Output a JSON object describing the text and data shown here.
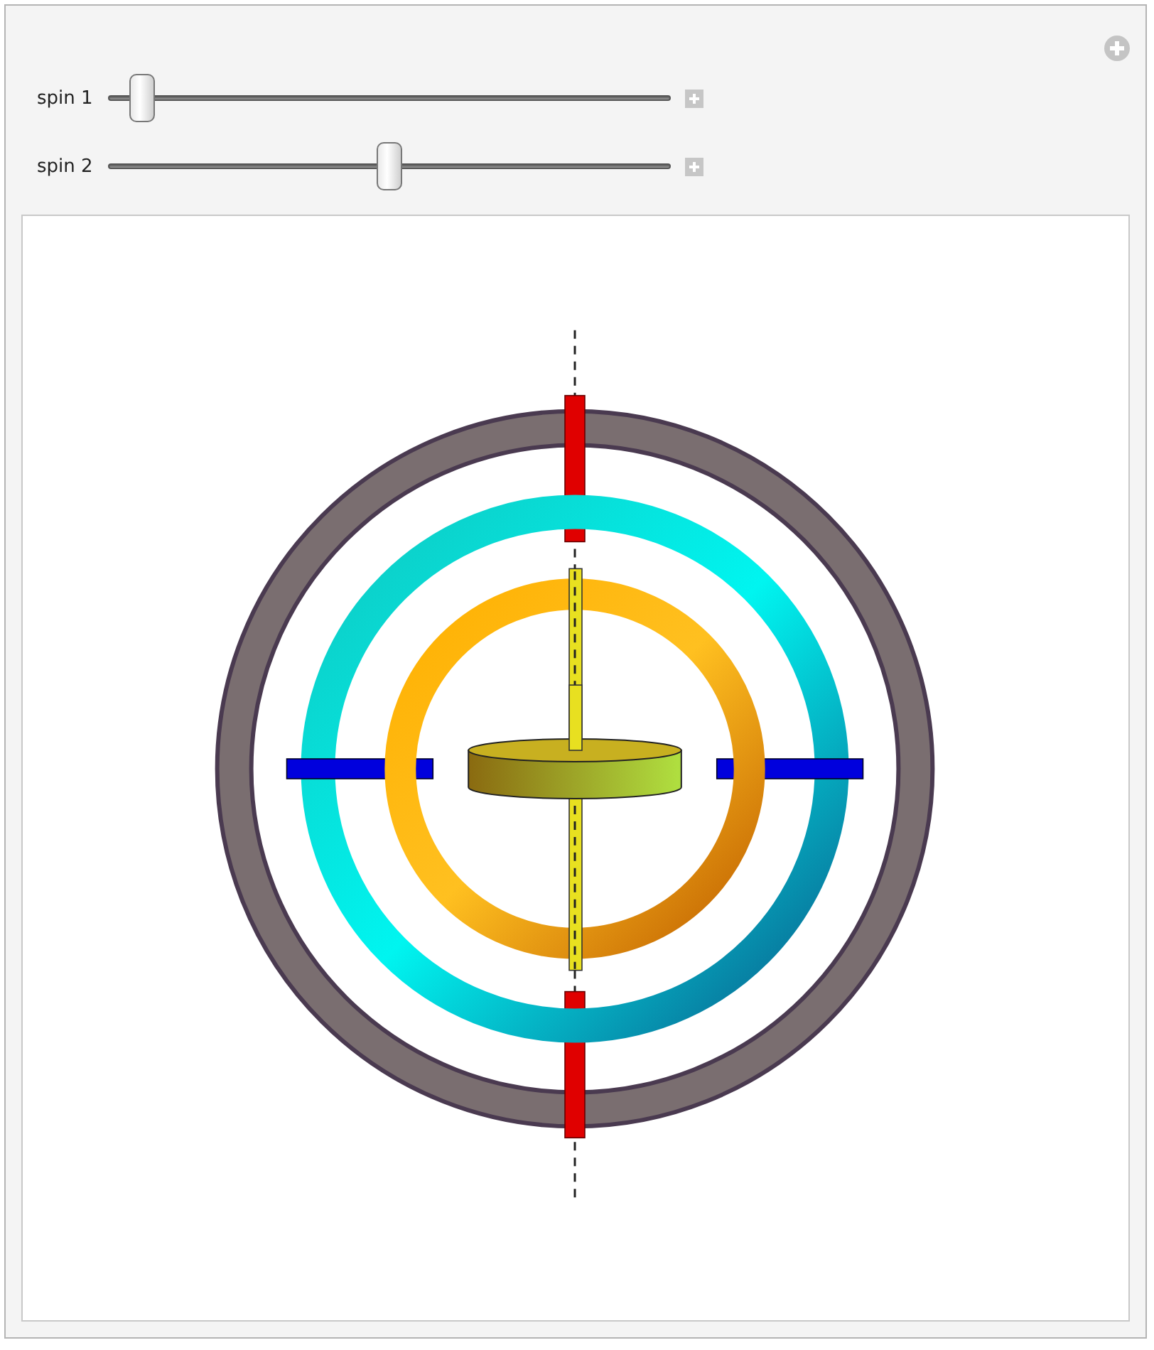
{
  "sliders": [
    {
      "label": "spin 1",
      "level": 0.04
    },
    {
      "label": "spin 2",
      "level": 0.5
    }
  ]
}
